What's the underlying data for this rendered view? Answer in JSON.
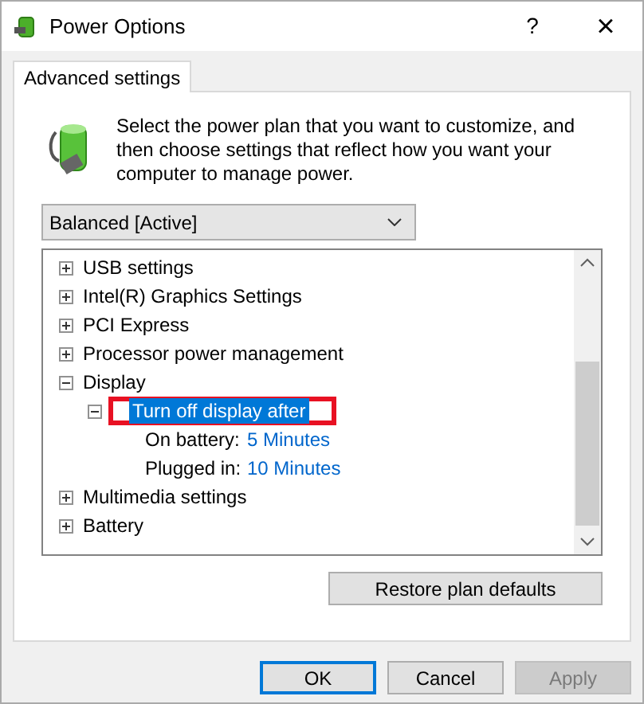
{
  "window": {
    "title": "Power Options",
    "help": "?",
    "close": "×"
  },
  "tabs": [
    {
      "label": "Advanced settings",
      "selected": true
    }
  ],
  "intro": "Select the power plan that you want to customize, and then choose settings that reflect how you want your computer to manage power.",
  "plan_dropdown": {
    "value": "Balanced [Active]"
  },
  "tree": [
    {
      "label": "USB settings",
      "expanded": false,
      "selected": false
    },
    {
      "label": "Intel(R) Graphics Settings",
      "expanded": false,
      "selected": false
    },
    {
      "label": "PCI Express",
      "expanded": false,
      "selected": false
    },
    {
      "label": "Processor power management",
      "expanded": false,
      "selected": false
    },
    {
      "label": "Display",
      "expanded": true,
      "selected": false,
      "children": [
        {
          "label": "Turn off display after",
          "expanded": true,
          "selected": true,
          "highlighted": true,
          "settings": [
            {
              "label": "On battery:",
              "value": "5 Minutes"
            },
            {
              "label": "Plugged in:",
              "value": "10 Minutes"
            }
          ]
        }
      ]
    },
    {
      "label": "Multimedia settings",
      "expanded": false,
      "selected": false
    },
    {
      "label": "Battery",
      "expanded": false,
      "selected": false
    }
  ],
  "restore_button": "Restore plan defaults",
  "buttons": [
    {
      "label": "OK",
      "default": true,
      "disabled": false
    },
    {
      "label": "Cancel",
      "default": false,
      "disabled": false
    },
    {
      "label": "Apply",
      "default": false,
      "disabled": true
    }
  ]
}
